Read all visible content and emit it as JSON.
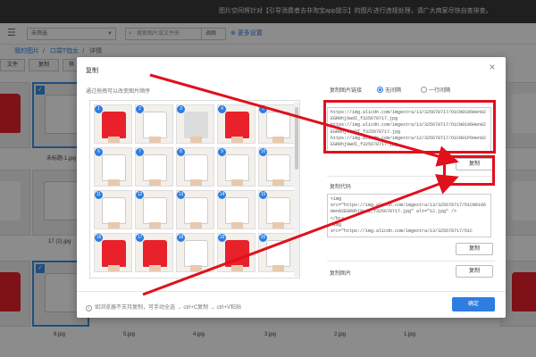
{
  "notice": "图片空间将针对【引导消费者去非淘宝app提示】的图片进行违规处理，请广大商家尽快自查排查。",
  "toolbar": {
    "filter_select": "未筛选",
    "search_placeholder": "搜索图片或文件夹",
    "search_scope": "调图",
    "more_settings": "更多设置"
  },
  "breadcrumb": [
    "我的图片",
    "口袋T恤女",
    "详情"
  ],
  "actions": {
    "file": "文件",
    "copy": "复制",
    "move": "移"
  },
  "background_files": [
    {
      "name": "未标题-1.jpg"
    },
    {
      "name": "17 (2).jpg"
    },
    {
      "name": "6.jpg"
    },
    {
      "name": "5.jpg"
    },
    {
      "name": "4.jpg"
    },
    {
      "name": "3.jpg"
    },
    {
      "name": "2.jpg"
    },
    {
      "name": "1.jpg"
    }
  ],
  "dialog": {
    "title": "复制",
    "drag_hint": "通过拖拽可以改变图片顺序",
    "thumbs": [
      {
        "num": "1",
        "color": "#e8212b"
      },
      {
        "num": "2",
        "color": "#ffffff"
      },
      {
        "num": "3",
        "color": "#dcdcdc"
      },
      {
        "num": "4",
        "color": "#e8212b"
      },
      {
        "num": "5",
        "color": "#ffffff"
      },
      {
        "num": "6",
        "color": "#ffffff"
      },
      {
        "num": "7",
        "color": "#ffffff"
      },
      {
        "num": "8",
        "color": "#ffffff"
      },
      {
        "num": "9",
        "color": "#ffffff"
      },
      {
        "num": "10",
        "color": "#ffffff"
      },
      {
        "num": "11",
        "color": "#ffffff"
      },
      {
        "num": "12",
        "color": "#ffffff"
      },
      {
        "num": "13",
        "color": "#ffffff"
      },
      {
        "num": "14",
        "color": "#ffffff"
      },
      {
        "num": "15",
        "color": "#ffffff"
      },
      {
        "num": "16",
        "color": "#e8212b"
      },
      {
        "num": "17",
        "color": "#e8212b"
      },
      {
        "num": "18",
        "color": "#ffffff"
      },
      {
        "num": "19",
        "color": "#e8212b"
      },
      {
        "num": "20",
        "color": "#ffffff"
      }
    ],
    "link_section": {
      "title": "复制图片链接",
      "option_no_gap": "无间隔",
      "option_per_line": "一行间隔",
      "text": "https://img.alicdn.com/imgextra/i3/325678717/O1CN0106Hen02EGR0hj9wdI_f325678717.jpg\nhttps://img.alicdn.com/imgextra/i3/325678717/O1CN0106Hen02EGR0hj76nOT_f325678717.jpg\nhttps://img.alicdn.com/imgextra/i2/325678717/O1CN01P6Hen02EGR0hj9wdI_f325678717.jpg",
      "copy_label": "复制"
    },
    "code_section": {
      "title": "复制代码",
      "text": "<img\nsrc=\"https://img.alicdn.com/imgextra/i3/325678717/O1CN0106Hen02EGR0hj9wdI_f325678717.jpg\" alt=\"12.jpg\" />\n</br>\n<img\nsrc=\"https://img.alicdn.com/imgextra/i3/325678717/O1C",
      "copy_label": "复制"
    },
    "image_section": {
      "title": "复制图片",
      "copy_label": "复制"
    },
    "footer_note": "如浏览器不支持复制，可手动全选 → ctrl+C复制 → ctrl+V粘贴",
    "ok_label": "确定"
  },
  "colors": {
    "highlight": "#e0101d",
    "accent": "#2f7de1",
    "overlay": "rgba(0,0,0,0.45)"
  }
}
